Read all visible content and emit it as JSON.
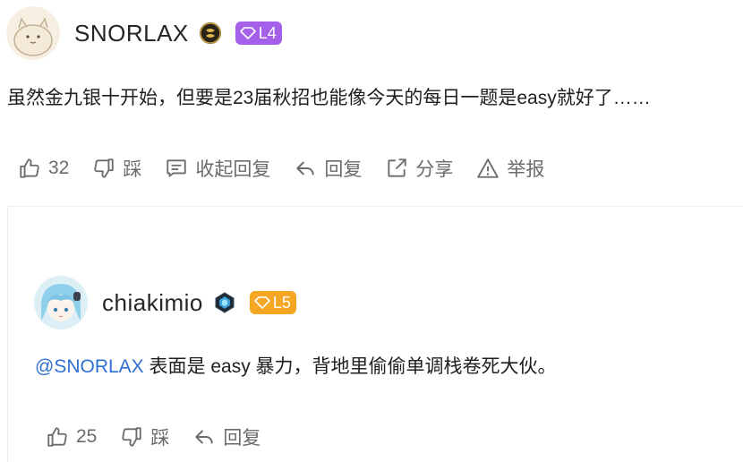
{
  "comment": {
    "author": "SNORLAX",
    "level": "L4",
    "text": "虽然金九银十开始，但要是23届秋招也能像今天的每日一题是easy就好了……",
    "actions": {
      "like_count": "32",
      "dislike_label": "踩",
      "collapse_label": "收起回复",
      "reply_label": "回复",
      "share_label": "分享",
      "report_label": "举报"
    }
  },
  "reply": {
    "author": "chiakimio",
    "level": "L5",
    "mention": "@SNORLAX",
    "text": "表面是 easy 暴力，背地里偷偷单调栈卷死大伙。",
    "actions": {
      "like_count": "25",
      "dislike_label": "踩",
      "reply_label": "回复"
    }
  },
  "colors": {
    "mention": "#2f6fd1",
    "level_l4": "#a560ea",
    "level_l5": "#f5a623",
    "action_text": "#6b6b6b"
  },
  "icons": [
    "thumbs-up-icon",
    "thumbs-down-icon",
    "comment-icon",
    "reply-arrow-icon",
    "share-icon",
    "warning-icon",
    "gem-icon"
  ]
}
